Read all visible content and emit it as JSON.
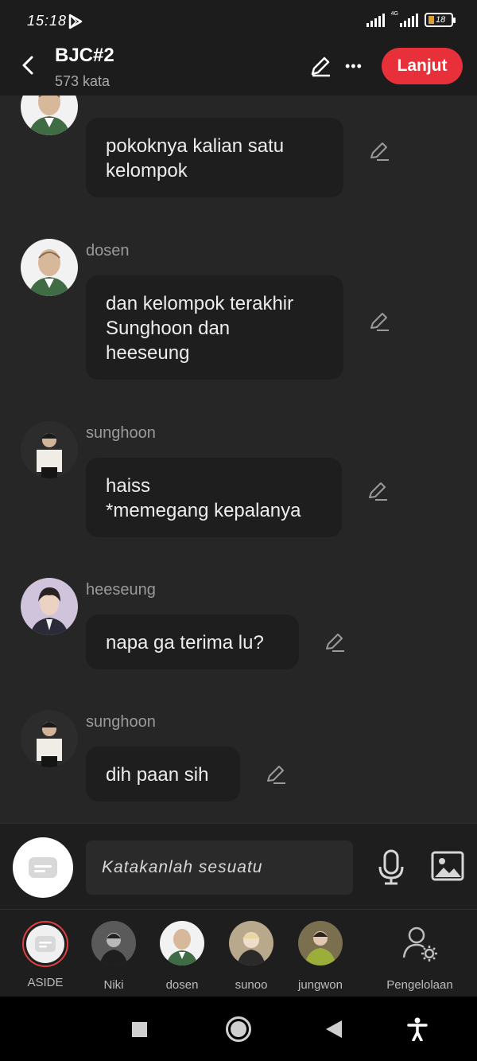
{
  "status": {
    "time": "15:18",
    "network": "4G",
    "battery": "18"
  },
  "header": {
    "title": "BJC#2",
    "subtitle": "573 kata",
    "next_label": "Lanjut"
  },
  "messages": [
    {
      "speaker": "dosen",
      "text": "pokoknya kalian satu\nkelompok"
    },
    {
      "speaker": "dosen",
      "text": "dan kelompok terakhir\nSunghoon dan\nheeseung"
    },
    {
      "speaker": "sunghoon",
      "text": "haiss\n*memegang kepalanya"
    },
    {
      "speaker": "heeseung",
      "text": "napa ga terima lu?"
    },
    {
      "speaker": "sunghoon",
      "text": "dih paan sih"
    }
  ],
  "input": {
    "placeholder": "Katakanlah sesuatu"
  },
  "characters": [
    {
      "label": "ASIDE",
      "selected": true
    },
    {
      "label": "Niki"
    },
    {
      "label": "dosen"
    },
    {
      "label": "sunoo"
    },
    {
      "label": "jungwon"
    },
    {
      "label": "Pengelolaan"
    }
  ],
  "colors": {
    "accent": "#e8303a",
    "background": "#262626",
    "bubble": "#1e1e1e"
  },
  "icons": [
    "back-arrow-icon",
    "pencil-icon",
    "more-icon",
    "microphone-icon",
    "image-icon",
    "aside-chat-icon",
    "manage-user-icon"
  ]
}
